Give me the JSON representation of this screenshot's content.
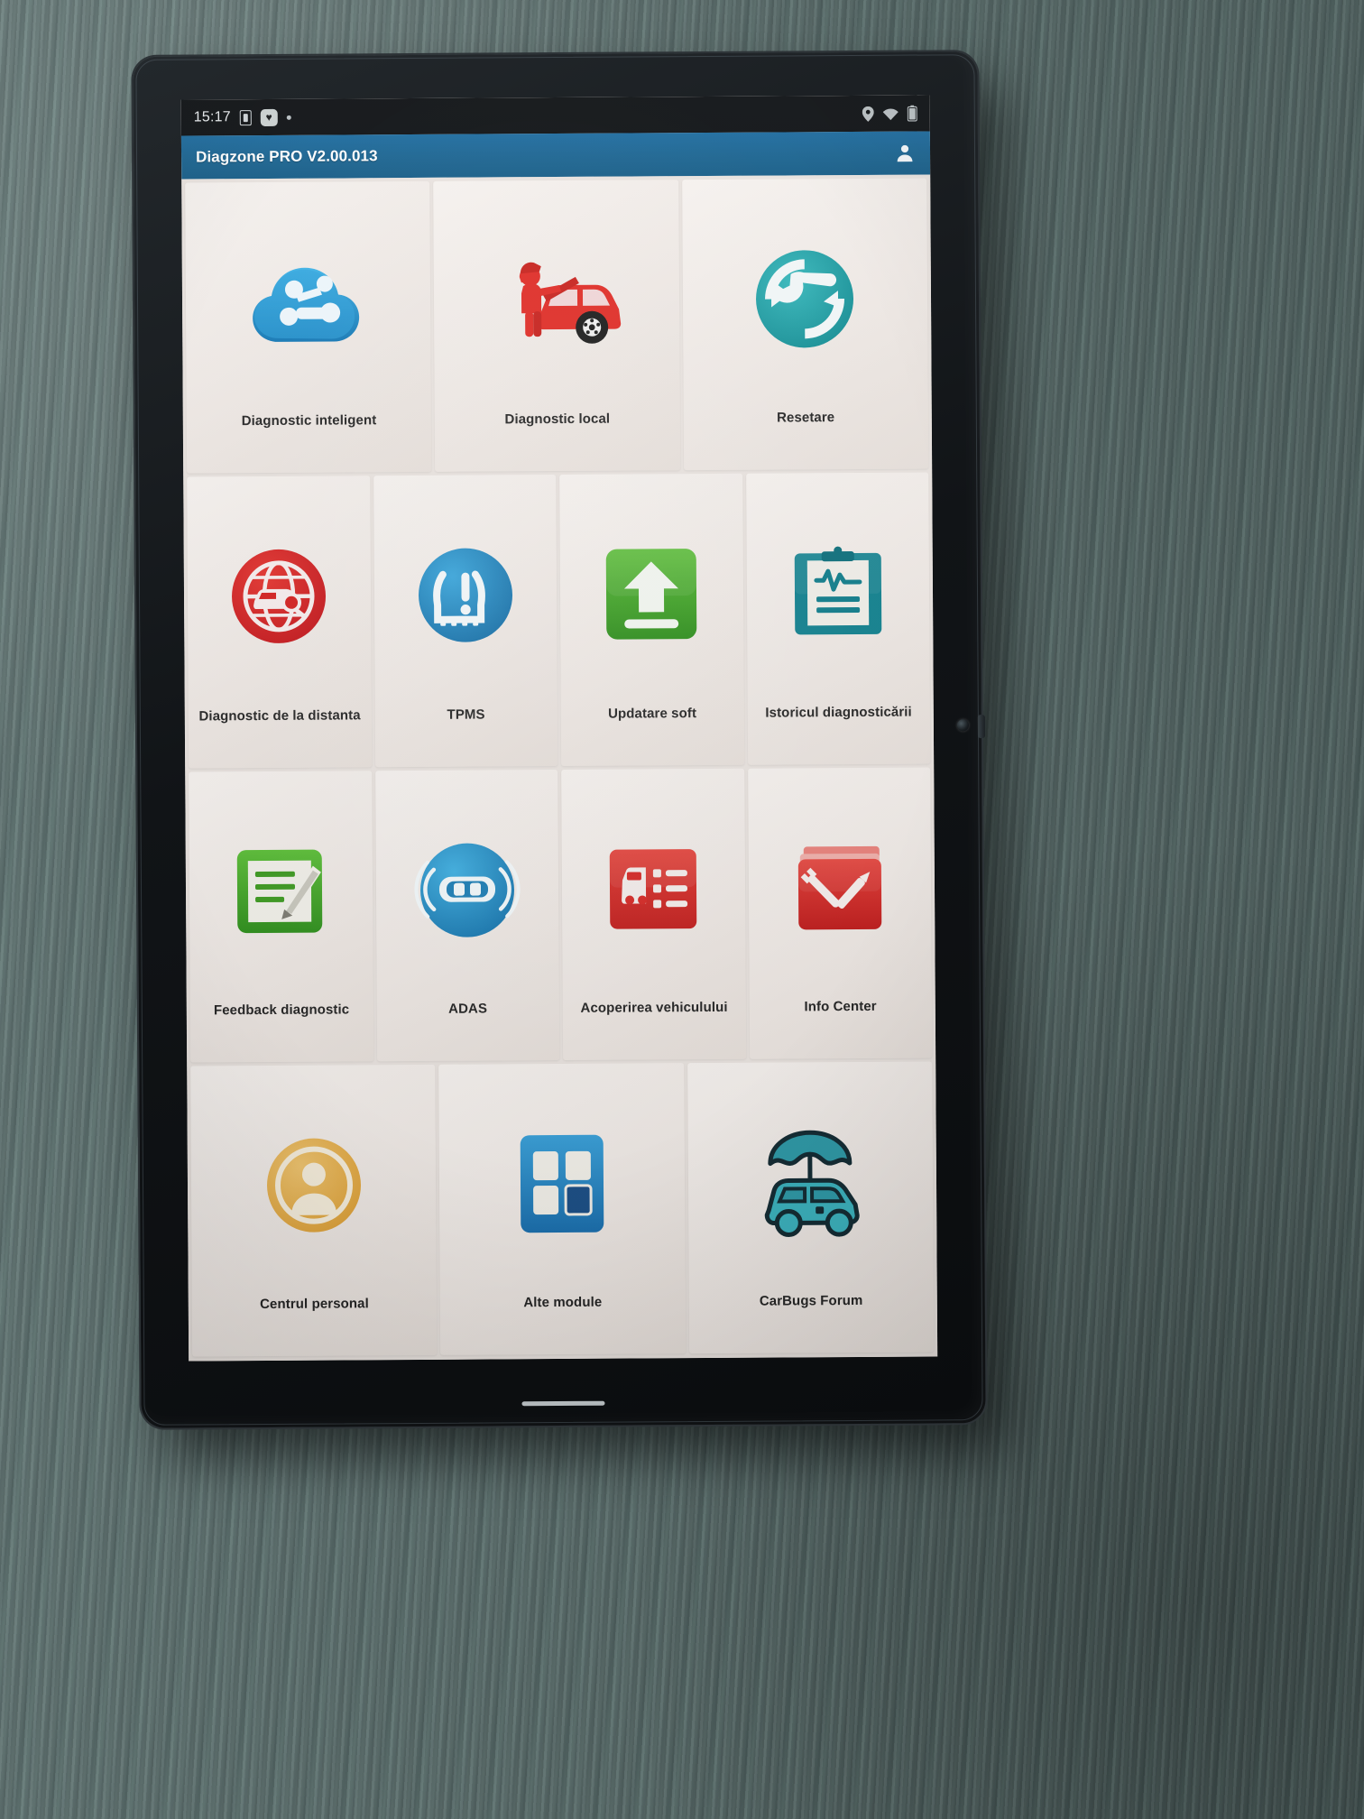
{
  "statusbar": {
    "time": "15:17",
    "icons_left": [
      "sim-card-icon",
      "heart-health-icon",
      "dot-icon"
    ],
    "icons_right": [
      "location-icon",
      "wifi-icon",
      "battery-icon"
    ]
  },
  "titlebar": {
    "app_title": "Diagzone PRO V2.00.013",
    "account_icon": "user-account-icon"
  },
  "colors": {
    "titlebar_blue": "#18628f",
    "tile_bg": "#f2ece8",
    "screen_bg": "#e9e3df",
    "cloud_blue": "#1f8fc9",
    "red": "#d8232a",
    "green": "#4cae2e",
    "teal": "#1b93a3",
    "orange": "#e8b14b",
    "blue": "#1f7fc4"
  },
  "grid": {
    "rows": [
      {
        "tiles": [
          {
            "label": "Diagnostic inteligent",
            "icon": "smart-diagnosis-cloud-icon"
          },
          {
            "label": "Diagnostic local",
            "icon": "local-diagnosis-mechanic-icon"
          },
          {
            "label": "Resetare",
            "icon": "reset-wrench-icon"
          }
        ]
      },
      {
        "tiles": [
          {
            "label": "Diagnostic de la distanta",
            "icon": "remote-diagnosis-icon"
          },
          {
            "label": "TPMS",
            "icon": "tpms-tire-pressure-icon"
          },
          {
            "label": "Updatare soft",
            "icon": "software-update-arrow-icon"
          },
          {
            "label": "Istoricul diagnosticării",
            "icon": "diagnostic-history-clipboard-icon"
          }
        ]
      },
      {
        "tiles": [
          {
            "label": "Feedback diagnostic",
            "icon": "feedback-pencil-icon"
          },
          {
            "label": "ADAS",
            "icon": "adas-car-radar-icon"
          },
          {
            "label": "Acoperirea vehiculului",
            "icon": "vehicle-coverage-list-icon"
          },
          {
            "label": "Info Center",
            "icon": "info-center-book-icon"
          }
        ]
      },
      {
        "tiles": [
          {
            "label": "Centrul personal",
            "icon": "personal-center-user-icon"
          },
          {
            "label": "Alte module",
            "icon": "other-modules-grid-icon"
          },
          {
            "label": "CarBugs Forum",
            "icon": "carbugs-forum-umbrella-car-icon"
          }
        ]
      }
    ]
  }
}
